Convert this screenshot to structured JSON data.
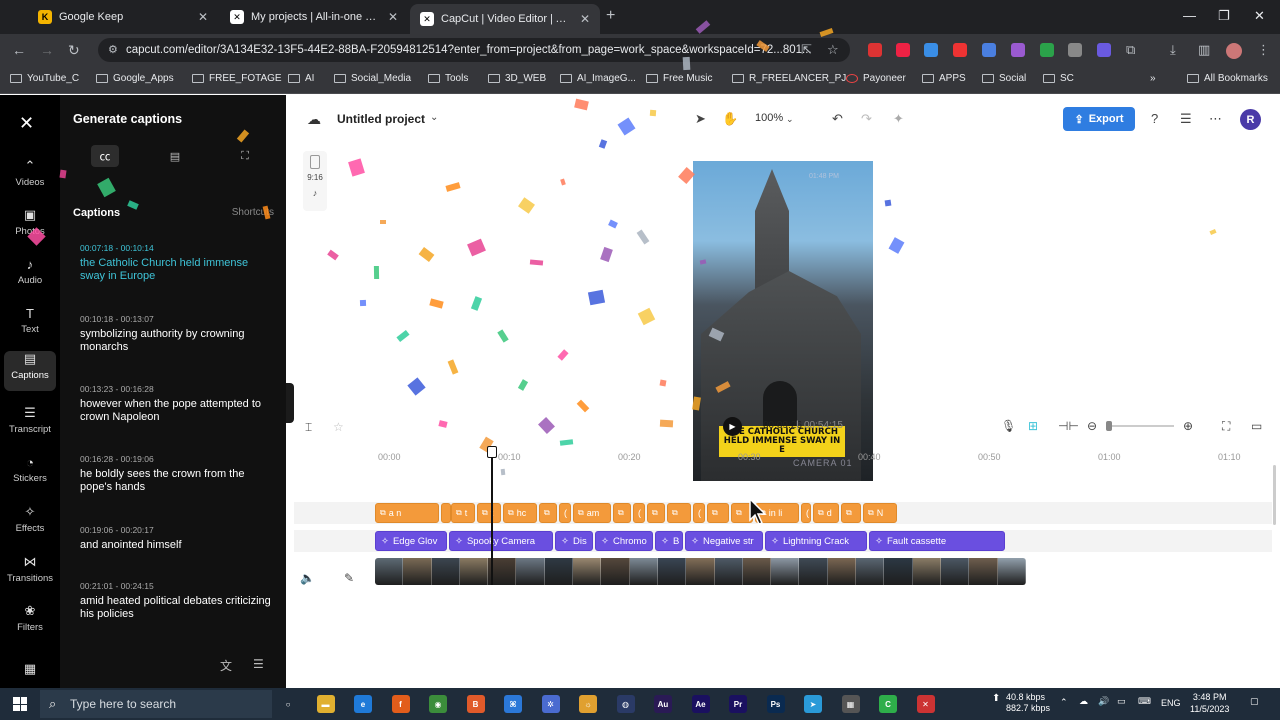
{
  "browser": {
    "tabs": [
      {
        "title": "Google Keep",
        "color": "#f4b400",
        "glyph": "K"
      },
      {
        "title": "My projects | All-in-one video",
        "color": "#ffffff",
        "glyph": "✕"
      },
      {
        "title": "CapCut | Video Editor | All-in",
        "color": "#ffffff",
        "glyph": "✕",
        "active": true
      }
    ],
    "url": "capcut.com/editor/3A134E32-13F5-44E2-88BA-F20594812514?enter_from=project&from_page=work_space&workspaceId=72...801...",
    "bookmarks": [
      "YouTube_C",
      "Google_Apps",
      "FREE_FOTAGE",
      "AI",
      "Social_Media",
      "Tools",
      "3D_WEB",
      "AI_ImageG...",
      "Free Music",
      "R_FREELANCER_PJ",
      "Payoneer",
      "APPS",
      "Social",
      "SC"
    ],
    "all_bookmarks": "All Bookmarks",
    "overflow": "»"
  },
  "rail": {
    "items": [
      {
        "label": "Videos",
        "icon": "▢"
      },
      {
        "label": "Photos",
        "icon": "▣"
      },
      {
        "label": "Audio",
        "icon": "♪"
      },
      {
        "label": "Text",
        "icon": "T"
      },
      {
        "label": "Captions",
        "icon": "▤",
        "active": true
      },
      {
        "label": "Transcript",
        "icon": "☰"
      },
      {
        "label": "Stickers",
        "icon": "◔"
      },
      {
        "label": "Effects",
        "icon": "✧"
      },
      {
        "label": "Transitions",
        "icon": "⋈"
      },
      {
        "label": "Filters",
        "icon": "❀"
      }
    ],
    "bottom_icon": "▦"
  },
  "panel": {
    "title": "Generate captions",
    "heading": "Captions",
    "shortcuts": "Shortcuts",
    "captions": [
      {
        "time": "00:07:18 - 00:10:14",
        "text": "the Catholic Church held immense sway in Europe",
        "selected": true
      },
      {
        "time": "00:10:18 - 00:13:07",
        "text": "symbolizing authority by crowning monarchs"
      },
      {
        "time": "00:13:23 - 00:16:28",
        "text": "however when the pope attempted to crown Napoleon"
      },
      {
        "time": "00:16:28 - 00:19:06",
        "text": "he boldly sees the crown from the pope's hands"
      },
      {
        "time": "00:19:06 - 00:20:17",
        "text": "and anointed himself"
      },
      {
        "time": "00:21:01 - 00:24:15",
        "text": "amid heated political debates criticizing his policies"
      }
    ]
  },
  "editor": {
    "project_name": "Untitled project",
    "zoom": "100%",
    "export": "Export",
    "user_initial": "R",
    "ratio": "9:16",
    "video_caption": "THE CATHOLIC CHURCH HELD IMMENSE SWAY IN E",
    "video_watermark": "CAMERA 01",
    "video_corner": "01:48 PM",
    "time_current": "00:09:26",
    "time_total": "00:54:15"
  },
  "timeline": {
    "ticks": [
      "00:00",
      "00:10",
      "00:20",
      "00:30",
      "00:40",
      "00:50",
      "01:00",
      "01:10"
    ],
    "caption_clips": [
      {
        "label": "a n",
        "w": 64
      },
      {
        "label": "",
        "w": 8
      },
      {
        "label": "t",
        "w": 24
      },
      {
        "label": "t",
        "w": 24
      },
      {
        "label": "hc",
        "w": 34
      },
      {
        "label": "",
        "w": 18
      },
      {
        "label": "(",
        "w": 12
      },
      {
        "label": "am",
        "w": 38
      },
      {
        "label": "",
        "w": 18
      },
      {
        "label": "(",
        "w": 12
      },
      {
        "label": "",
        "w": 18
      },
      {
        "label": "",
        "w": 24
      },
      {
        "label": "(",
        "w": 12
      },
      {
        "label": "",
        "w": 22
      },
      {
        "label": "",
        "w": 22
      },
      {
        "label": "in li",
        "w": 44
      },
      {
        "label": "(",
        "w": 10
      },
      {
        "label": "d",
        "w": 26
      },
      {
        "label": "",
        "w": 20
      },
      {
        "label": "N",
        "w": 34
      }
    ],
    "effect_clips": [
      {
        "label": "Edge Glov",
        "w": 72
      },
      {
        "label": "Spooky Camera",
        "w": 104
      },
      {
        "label": "Dis",
        "w": 38
      },
      {
        "label": "Chromo",
        "w": 58
      },
      {
        "label": "B",
        "w": 28
      },
      {
        "label": "Negative str",
        "w": 78
      },
      {
        "label": "Lightning Crack",
        "w": 102
      },
      {
        "label": "Fault cassette",
        "w": 136
      }
    ]
  },
  "taskbar": {
    "search_placeholder": "Type here to search",
    "net_up": "40.8 kbps",
    "net_down": "882.7 kbps",
    "lang": "ENG",
    "time": "3:48 PM",
    "date": "11/5/2023",
    "apps": [
      {
        "label": "○",
        "color": "transparent"
      },
      {
        "label": "▬",
        "color": "#e0b030"
      },
      {
        "label": "e",
        "color": "#1f7ad8"
      },
      {
        "label": "f",
        "color": "#e25d1b"
      },
      {
        "label": "◉",
        "color": "#3b8d3b"
      },
      {
        "label": "B",
        "color": "#e05a2a"
      },
      {
        "label": "⌘",
        "color": "#2b78d8"
      },
      {
        "label": "✲",
        "color": "#4a6bd0"
      },
      {
        "label": "☼",
        "color": "#e0a030"
      },
      {
        "label": "◍",
        "color": "#2a3a66"
      },
      {
        "label": "Au",
        "color": "#2a1a55"
      },
      {
        "label": "Ae",
        "color": "#1a1060"
      },
      {
        "label": "Pr",
        "color": "#1a1060"
      },
      {
        "label": "Ps",
        "color": "#0a2a50"
      },
      {
        "label": "➤",
        "color": "#2a9ad8"
      },
      {
        "label": "▦",
        "color": "#555"
      },
      {
        "label": "C",
        "color": "#2eae4a"
      },
      {
        "label": "✕",
        "color": "#c33"
      }
    ]
  },
  "colors": {
    "accent": "#2f7de1",
    "caption_clip": "#f39a3b",
    "effect_clip": "#6a4fe0",
    "selected_caption": "#3fc4d8"
  }
}
